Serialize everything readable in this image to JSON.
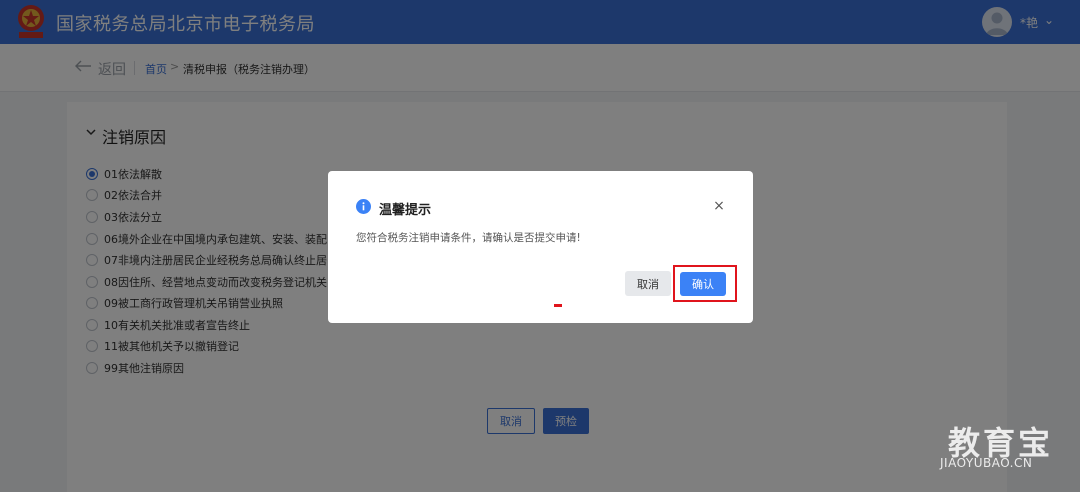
{
  "header": {
    "title": "国家税务总局北京市电子税务局",
    "user_name": "*艳",
    "chevron": "⌄",
    "emblem_icon": "tax-emblem-icon",
    "avatar_icon": "user-avatar-icon"
  },
  "breadcrumb": {
    "back_label": "返回",
    "home": "首页",
    "separator": ">",
    "current": "清税申报（税务注销办理）"
  },
  "section": {
    "title": "注销原因"
  },
  "reasons": [
    {
      "label": "01依法解散",
      "checked": true
    },
    {
      "label": "02依法合并",
      "checked": false
    },
    {
      "label": "03依法分立",
      "checked": false
    },
    {
      "label": "06境外企业在中国境内承包建筑、安装、装配",
      "checked": false
    },
    {
      "label": "07非境内注册居民企业经税务总局确认终止居",
      "checked": false
    },
    {
      "label": "08因住所、经营地点变动而改变税务登记机关",
      "checked": false
    },
    {
      "label": "09被工商行政管理机关吊销营业执照",
      "checked": false
    },
    {
      "label": "10有关机关批准或者宣告终止",
      "checked": false
    },
    {
      "label": "11被其他机关予以撤销登记",
      "checked": false
    },
    {
      "label": "99其他注销原因",
      "checked": false
    }
  ],
  "form_buttons": {
    "cancel": "取消",
    "precheck": "预检"
  },
  "dialog": {
    "title": "温馨提示",
    "close": "×",
    "message": "您符合税务注销申请条件，请确认是否提交申请!",
    "cancel": "取消",
    "confirm": "确认"
  },
  "watermark": {
    "main": "教育宝",
    "sub": "JIAOYUBAO.CN"
  },
  "colors": {
    "header_bg": "#3b71d6",
    "primary": "#3b82f6",
    "highlight": "#e0141c"
  }
}
